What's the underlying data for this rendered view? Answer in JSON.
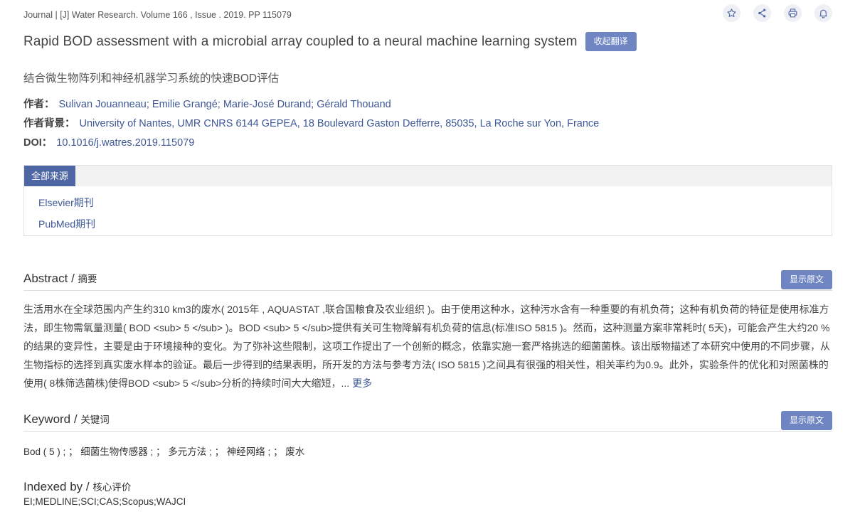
{
  "header": {
    "journal_line": "Journal | [J] Water Research. Volume 166 , Issue . 2019. PP 115079",
    "icons": [
      "star-icon",
      "share-icon",
      "print-icon",
      "bell-icon"
    ]
  },
  "article": {
    "title_en": "Rapid BOD assessment with a microbial array coupled to a neural machine learning system",
    "fold_translation_label": "收起翻译",
    "title_cn": "结合微生物阵列和神经机器学习系统的快速BOD评估",
    "authors_label": "作者：",
    "authors": "Sulivan Jouanneau; Emilie Grangé; Marie-José Durand; Gérald Thouand",
    "affiliation_label": "作者背景：",
    "affiliation": "University of Nantes, UMR CNRS 6144 GEPEA, 18 Boulevard Gaston Defferre, 85035, La Roche sur Yon, France",
    "doi_label": "DOI：",
    "doi": "10.1016/j.watres.2019.115079"
  },
  "sources": {
    "tab_label": "全部来源",
    "items": [
      "Elsevier期刊",
      "PubMed期刊"
    ]
  },
  "abstract": {
    "title_en": "Abstract / ",
    "title_cn": "摘要",
    "show_original_label": "显示原文",
    "text": "生活用水在全球范围内产生约310 km3的废水( 2015年 , AQUASTAT ,联合国粮食及农业组织 )。由于使用这种水，这种污水含有一种重要的有机负荷；这种有机负荷的特征是使用标准方法，即生物需氧量测量( BOD <sub> 5 </sub> )。BOD <sub> 5 </sub>提供有关可生物降解有机负荷的信息(标准ISO 5815 )。然而，这种测量方案非常耗时( 5天)，可能会产生大约20 %的结果的变异性，主要是由于环境接种的变化。为了弥补这些限制，这项工作提出了一个创新的概念，依靠实施一套严格挑选的细菌菌株。该出版物描述了本研究中使用的不同步骤，从生物指标的选择到真实废水样本的验证。最后一步得到的结果表明，所开发的方法与参考方法( ISO 5815 )之间具有很强的相关性，相关率约为0.9。此外，实验条件的优化和对照菌株的使用( 8株筛选菌株)使得BOD <sub> 5 </sub>分析的持续时间大大缩短，... ",
    "more_label": "更多"
  },
  "keyword": {
    "title_en": "Keyword / ",
    "title_cn": "关键词",
    "show_original_label": "显示原文",
    "text": "Bod ( 5 ) ; ； 细菌生物传感器 ; ； 多元方法 ; ； 神经网络 ; ； 废水"
  },
  "indexed": {
    "title_en": "Indexed by / ",
    "title_cn": "核心评价",
    "value": "EI;MEDLINE;SCI;CAS;Scopus;WAJCI"
  }
}
